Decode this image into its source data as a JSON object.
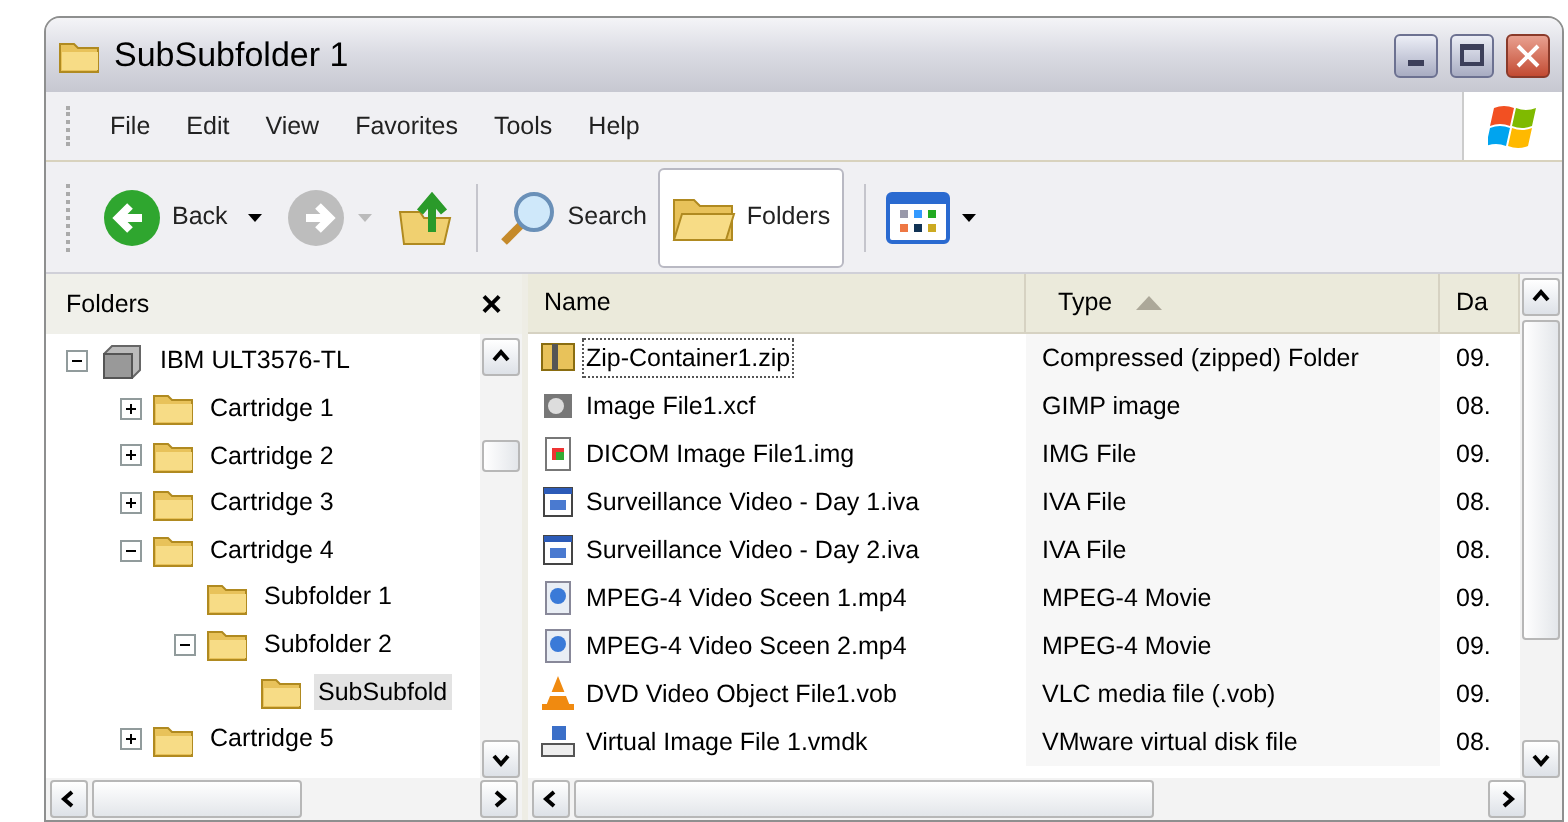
{
  "window": {
    "title": "SubSubfolder 1"
  },
  "menu": [
    "File",
    "Edit",
    "View",
    "Favorites",
    "Tools",
    "Help"
  ],
  "toolbar": {
    "back": "Back",
    "search": "Search",
    "folders": {
      "label": "Folders",
      "selected": true
    }
  },
  "folders_pane": {
    "title": "Folders",
    "close": "×",
    "tree": [
      {
        "label": "IBM ULT3576-TL",
        "kind": "drive",
        "expanded": true,
        "selected": false,
        "children": [
          {
            "label": "Cartridge 1",
            "kind": "folder",
            "expanded": false,
            "selected": false
          },
          {
            "label": "Cartridge 2",
            "kind": "folder",
            "expanded": false,
            "selected": false
          },
          {
            "label": "Cartridge 3",
            "kind": "folder",
            "expanded": false,
            "selected": false
          },
          {
            "label": "Cartridge 4",
            "kind": "folder",
            "expanded": true,
            "selected": false,
            "children": [
              {
                "label": "Subfolder 1",
                "kind": "folder",
                "selected": false
              },
              {
                "label": "Subfolder 2",
                "kind": "folder",
                "expanded": true,
                "selected": false,
                "children": [
                  {
                    "label": "SubSubfold",
                    "kind": "folder",
                    "selected": true
                  }
                ]
              }
            ]
          },
          {
            "label": "Cartridge 5",
            "kind": "folder",
            "expanded": false,
            "selected": false
          }
        ]
      }
    ]
  },
  "file_list": {
    "columns": [
      {
        "label": "Name",
        "sorted": false
      },
      {
        "label": "Type",
        "sorted": true
      },
      {
        "label": "Da",
        "sorted": false
      }
    ],
    "rows": [
      {
        "kind": "zip",
        "name": "Zip-Container1.zip",
        "type": "Compressed (zipped) Folder",
        "date": "09.",
        "selected": true
      },
      {
        "kind": "gimp",
        "name": "Image File1.xcf",
        "type": "GIMP image",
        "date": "08.",
        "selected": false
      },
      {
        "kind": "img",
        "name": "DICOM Image File1.img",
        "type": "IMG File",
        "date": "09.",
        "selected": false
      },
      {
        "kind": "iva",
        "name": "Surveillance Video - Day 1.iva",
        "type": "IVA File",
        "date": "08.",
        "selected": false
      },
      {
        "kind": "iva",
        "name": "Surveillance Video - Day 2.iva",
        "type": "IVA File",
        "date": "08.",
        "selected": false
      },
      {
        "kind": "mp4",
        "name": "MPEG-4 Video Sceen 1.mp4",
        "type": "MPEG-4 Movie",
        "date": "09.",
        "selected": false
      },
      {
        "kind": "mp4",
        "name": "MPEG-4 Video Sceen 2.mp4",
        "type": "MPEG-4 Movie",
        "date": "09.",
        "selected": false
      },
      {
        "kind": "vlc",
        "name": "DVD Video Object File1.vob",
        "type": "VLC media file (.vob)",
        "date": "09.",
        "selected": false
      },
      {
        "kind": "vmdk",
        "name": "Virtual Image File 1.vmdk",
        "type": "VMware virtual disk file",
        "date": "08.",
        "selected": false
      }
    ]
  }
}
